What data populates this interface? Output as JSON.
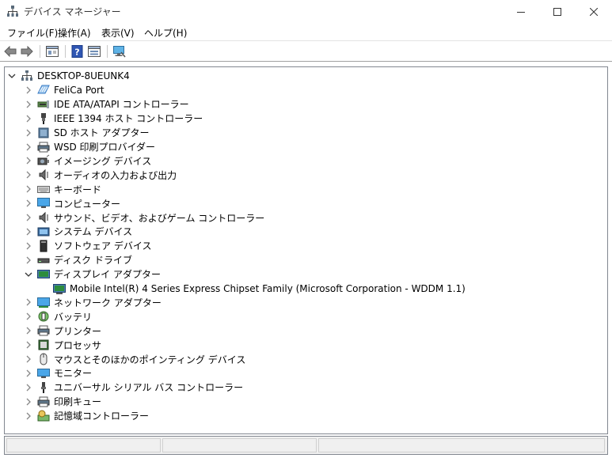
{
  "window": {
    "title": "デバイス マネージャー",
    "icon": "device-manager-icon",
    "controls": [
      "minimize",
      "maximize",
      "close"
    ]
  },
  "menu": [
    {
      "label": "ファイル(F)"
    },
    {
      "label": "操作(A)"
    },
    {
      "label": "表示(V)"
    },
    {
      "label": "ヘルプ(H)"
    }
  ],
  "toolbar": {
    "buttons": [
      "back-arrow-icon",
      "forward-arrow-icon",
      "properties-icon",
      "help-icon",
      "view-icon",
      "scan-hardware-icon"
    ]
  },
  "tree": {
    "root": {
      "label": "DESKTOP-8UEUNK4",
      "expanded": true,
      "icon": "computer-tree-icon"
    },
    "categories": [
      {
        "label": "FeliCa Port",
        "icon": "felica-icon",
        "expanded": false
      },
      {
        "label": "IDE ATA/ATAPI コントローラー",
        "icon": "ide-controller-icon",
        "expanded": false
      },
      {
        "label": "IEEE 1394 ホスト コントローラー",
        "icon": "ieee1394-icon",
        "expanded": false
      },
      {
        "label": "SD ホスト アダプター",
        "icon": "sd-host-icon",
        "expanded": false
      },
      {
        "label": "WSD 印刷プロバイダー",
        "icon": "wsd-printer-icon",
        "expanded": false
      },
      {
        "label": "イメージング デバイス",
        "icon": "imaging-device-icon",
        "expanded": false
      },
      {
        "label": "オーディオの入力および出力",
        "icon": "audio-io-icon",
        "expanded": false
      },
      {
        "label": "キーボード",
        "icon": "keyboard-icon",
        "expanded": false
      },
      {
        "label": "コンピューター",
        "icon": "computer-icon",
        "expanded": false
      },
      {
        "label": "サウンド、ビデオ、およびゲーム コントローラー",
        "icon": "sound-video-icon",
        "expanded": false
      },
      {
        "label": "システム デバイス",
        "icon": "system-device-icon",
        "expanded": false
      },
      {
        "label": "ソフトウェア デバイス",
        "icon": "software-device-icon",
        "expanded": false
      },
      {
        "label": "ディスク ドライブ",
        "icon": "disk-drive-icon",
        "expanded": false
      },
      {
        "label": "ディスプレイ アダプター",
        "icon": "display-adapter-icon",
        "expanded": true,
        "children": [
          {
            "label": "Mobile Intel(R) 4 Series Express Chipset Family (Microsoft Corporation - WDDM 1.1)",
            "icon": "display-adapter-device-icon"
          }
        ]
      },
      {
        "label": "ネットワーク アダプター",
        "icon": "network-adapter-icon",
        "expanded": false
      },
      {
        "label": "バッテリ",
        "icon": "battery-icon",
        "expanded": false
      },
      {
        "label": "プリンター",
        "icon": "printer-icon",
        "expanded": false
      },
      {
        "label": "プロセッサ",
        "icon": "processor-icon",
        "expanded": false
      },
      {
        "label": "マウスとそのほかのポインティング デバイス",
        "icon": "mouse-icon",
        "expanded": false
      },
      {
        "label": "モニター",
        "icon": "monitor-icon",
        "expanded": false
      },
      {
        "label": "ユニバーサル シリアル バス コントローラー",
        "icon": "usb-icon",
        "expanded": false
      },
      {
        "label": "印刷キュー",
        "icon": "print-queue-icon",
        "expanded": false
      },
      {
        "label": "記憶域コントローラー",
        "icon": "storage-controller-icon",
        "expanded": false
      }
    ]
  }
}
